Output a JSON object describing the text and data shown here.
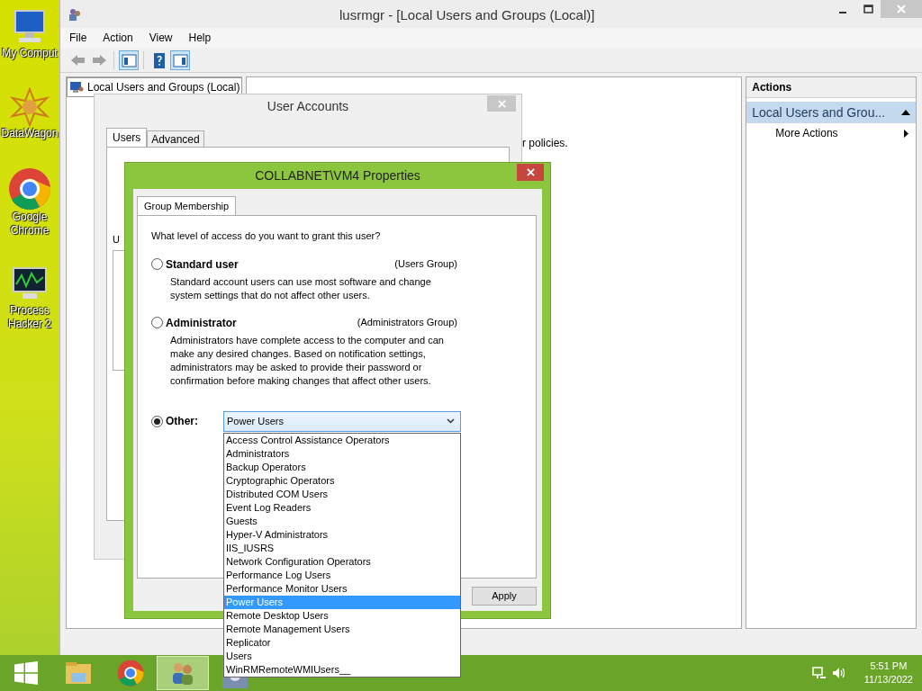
{
  "desktop_icons": [
    {
      "kind": "computer",
      "label": "My Comput"
    },
    {
      "kind": "star",
      "label": "DataWagon"
    },
    {
      "kind": "chrome",
      "label": "Google Chrome"
    },
    {
      "kind": "monitor",
      "label": "Process Hacker 2"
    }
  ],
  "main_window": {
    "title": "lusrmgr - [Local Users and Groups (Local)]",
    "menu": [
      "File",
      "Action",
      "View",
      "Help"
    ],
    "toolbar": [
      {
        "kind": "back",
        "pressed": false,
        "disabled": true
      },
      {
        "kind": "forward",
        "pressed": false,
        "disabled": true
      },
      {
        "kind": "tree",
        "pressed": true,
        "disabled": false
      },
      {
        "kind": "help",
        "pressed": false,
        "disabled": false
      },
      {
        "kind": "pane",
        "pressed": true,
        "disabled": false
      }
    ],
    "tree_item": "Local Users and Groups (Local)",
    "middle_text": "r policies.",
    "actions": {
      "header": "Actions",
      "section": "Local Users and Grou...",
      "items": [
        "More Actions"
      ]
    }
  },
  "user_accounts": {
    "title": "User Accounts",
    "tabs": [
      {
        "label": "Users",
        "selected": true
      },
      {
        "label": "Advanced",
        "selected": false
      }
    ],
    "partial_label": "U"
  },
  "properties": {
    "title": "COLLABNET\\VM4 Properties",
    "tabs": [
      {
        "label": "Group Membership",
        "selected": true
      }
    ],
    "question": "What level of access do you want to grant this user?",
    "options": [
      {
        "kind": "radio",
        "label": "Standard user",
        "group": "(Users Group)",
        "description": "Standard account users can use most software and change system settings that do not affect other users.",
        "selected": false
      },
      {
        "kind": "radio",
        "label": "Administrator",
        "group": "(Administrators Group)",
        "description": "Administrators have complete access to the computer and can make any desired changes. Based on notification settings, administrators may be asked to provide their password or confirmation before making changes that affect other users.",
        "selected": false
      },
      {
        "kind": "dropdown",
        "label": "Other:",
        "value": "Power Users",
        "selected": true,
        "list": [
          {
            "label": "Access Control Assistance Operators",
            "selected": false
          },
          {
            "label": "Administrators",
            "selected": false
          },
          {
            "label": "Backup Operators",
            "selected": false
          },
          {
            "label": "Cryptographic Operators",
            "selected": false
          },
          {
            "label": "Distributed COM Users",
            "selected": false
          },
          {
            "label": "Event Log Readers",
            "selected": false
          },
          {
            "label": "Guests",
            "selected": false
          },
          {
            "label": "Hyper-V Administrators",
            "selected": false
          },
          {
            "label": "IIS_IUSRS",
            "selected": false
          },
          {
            "label": "Network Configuration Operators",
            "selected": false
          },
          {
            "label": "Performance Log Users",
            "selected": false
          },
          {
            "label": "Performance Monitor Users",
            "selected": false
          },
          {
            "label": "Power Users",
            "selected": true
          },
          {
            "label": "Remote Desktop Users",
            "selected": false
          },
          {
            "label": "Remote Management Users",
            "selected": false
          },
          {
            "label": "Replicator",
            "selected": false
          },
          {
            "label": "Users",
            "selected": false
          },
          {
            "label": "WinRMRemoteWMIUsers__",
            "selected": false
          }
        ]
      }
    ],
    "buttons": [
      "Apply"
    ]
  },
  "taskbar": {
    "apps": [
      {
        "kind": "start",
        "selected": false
      },
      {
        "kind": "folder",
        "selected": false
      },
      {
        "kind": "chrome",
        "selected": false
      },
      {
        "kind": "users",
        "selected": true
      },
      {
        "kind": "app",
        "selected": false
      }
    ],
    "time": "5:51 PM",
    "date": "11/13/2022"
  }
}
